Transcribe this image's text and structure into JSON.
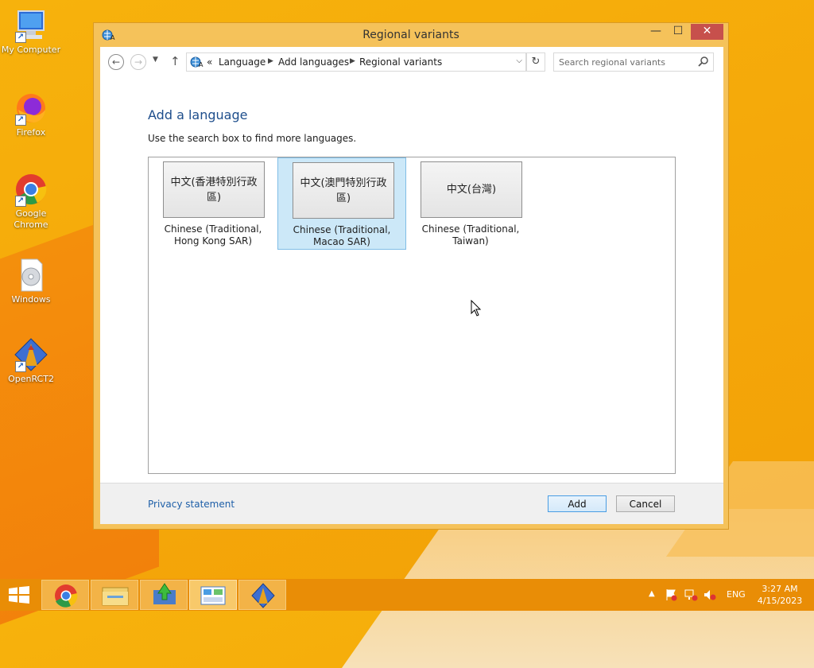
{
  "desktop": {
    "icons": [
      {
        "label": "My Computer"
      },
      {
        "label": "Firefox"
      },
      {
        "label": "Google Chrome"
      },
      {
        "label": "Windows"
      },
      {
        "label": "OpenRCT2"
      }
    ]
  },
  "window": {
    "title": "Regional variants",
    "controls": {
      "minimize": "—",
      "maximize": "☐",
      "close": "✕"
    }
  },
  "address_bar": {
    "overflow": "«",
    "crumbs": [
      "Language",
      "Add languages",
      "Regional variants"
    ],
    "search_placeholder": "Search regional variants"
  },
  "content": {
    "heading": "Add a language",
    "instruction": "Use the search box to find more languages.",
    "languages": [
      {
        "native": "中文(香港特別行政區)",
        "caption": "Chinese (Traditional, Hong Kong SAR)",
        "selected": false
      },
      {
        "native": "中文(澳門特別行政區)",
        "caption": "Chinese (Traditional, Macao SAR)",
        "selected": true
      },
      {
        "native": "中文(台灣)",
        "caption": "Chinese (Traditional, Taiwan)",
        "selected": false
      }
    ]
  },
  "footer": {
    "privacy": "Privacy statement",
    "add_label": "Add",
    "cancel_label": "Cancel"
  },
  "taskbar": {
    "language": "ENG",
    "time": "3:27 AM",
    "date": "4/15/2023"
  },
  "colors": {
    "accent": "#f5a90a",
    "taskbar": "#e98d06",
    "heading": "#1e4e8c",
    "link": "#1e5fa8",
    "selection": "#cce8f8"
  }
}
